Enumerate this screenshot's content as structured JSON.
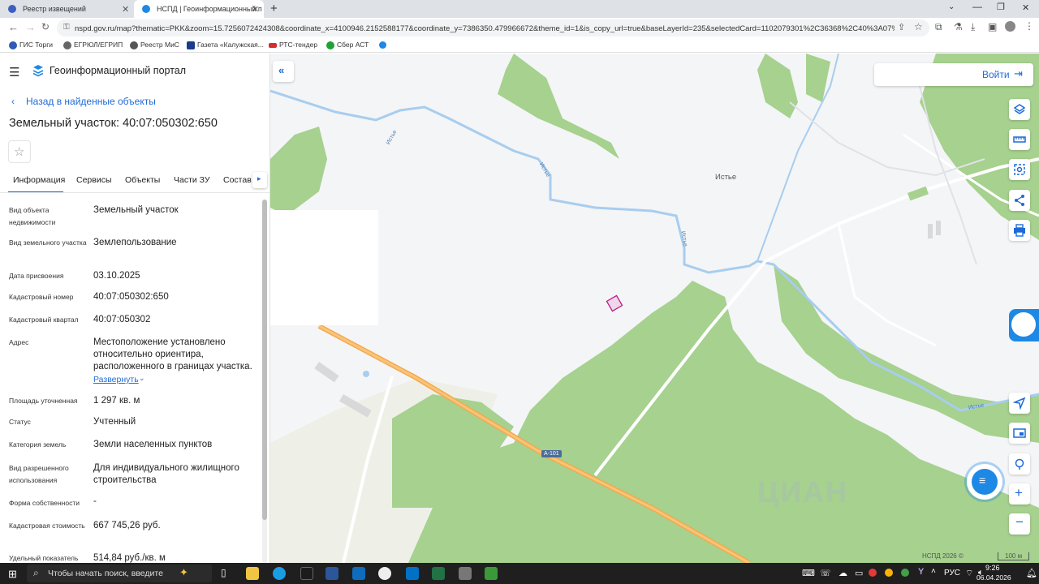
{
  "browser": {
    "tabs": [
      {
        "label": "Реестр извещений"
      },
      {
        "label": "НСПД | Геоинформационный п"
      }
    ],
    "url": "nspd.gov.ru/map?thematic=PKK&zoom=15.7256072424308&coordinate_x=4100946.2152588177&coordinate_y=7386350.479966672&theme_id=1&is_copy_url=true&baseLayerId=235&selectedCard=1102079301%2C36368%2C40%3A07%3A...",
    "bookmarks": [
      {
        "label": "ГИС Торги"
      },
      {
        "label": "ЕГРЮЛ/ЕГРИП"
      },
      {
        "label": "Реестр МиС"
      },
      {
        "label": "Газета «Калужская..."
      },
      {
        "label": "РТС-тендер"
      },
      {
        "label": "Сбер АСТ"
      }
    ]
  },
  "portal": {
    "title": "Геоинформационный портал",
    "back_link": "Назад в найденные объекты",
    "card_title": "Земельный участок: 40:07:050302:650",
    "tabs": [
      "Информация",
      "Сервисы",
      "Объекты",
      "Части ЗУ",
      "Состав"
    ],
    "expand_link": "Развернуть",
    "fields": [
      {
        "label": "Вид объекта недвижимости",
        "value": "Земельный участок"
      },
      {
        "label": "Вид земельного участка",
        "value": "Землепользование"
      },
      {
        "label": "Дата присвоения",
        "value": "03.10.2025"
      },
      {
        "label": "Кадастровый номер",
        "value": "40:07:050302:650"
      },
      {
        "label": "Кадастровый квартал",
        "value": "40:07:050302"
      },
      {
        "label": "Адрес",
        "value": "Местоположение установлено относительно ориентира, расположенного в границах участка."
      },
      {
        "label": "Площадь уточненная",
        "value": "1 297 кв. м"
      },
      {
        "label": "Статус",
        "value": "Учтенный"
      },
      {
        "label": "Категория земель",
        "value": "Земли населенных пунктов"
      },
      {
        "label": "Вид разрешенного использования",
        "value": "Для индивидуального жилищного строительства"
      },
      {
        "label": "Форма собственности",
        "value": "-"
      },
      {
        "label": "Кадастровая стоимость",
        "value": "667 745,26 руб."
      },
      {
        "label": "Удельный показатель",
        "value": "514,84 руб./кв. м"
      }
    ]
  },
  "map": {
    "login_label": "Войти",
    "labels": {
      "village": "Истье",
      "river1": "Истье",
      "river2": "Истье",
      "river3": "Истье",
      "river4": "Истье",
      "road": "А-101",
      "watermark": "ЦИАН"
    },
    "footer": {
      "copyright": "НСПД 2026 ©",
      "scale": "100 м"
    },
    "colors": {
      "forest": "#a6d18e",
      "river": "#a8cdee",
      "road": "#f5a94a",
      "parcel": "#c21b8a"
    }
  },
  "taskbar": {
    "search_placeholder": "Чтобы начать поиск, введите",
    "lang": "РУС",
    "time": "9:26",
    "date": "06.04.2026"
  }
}
